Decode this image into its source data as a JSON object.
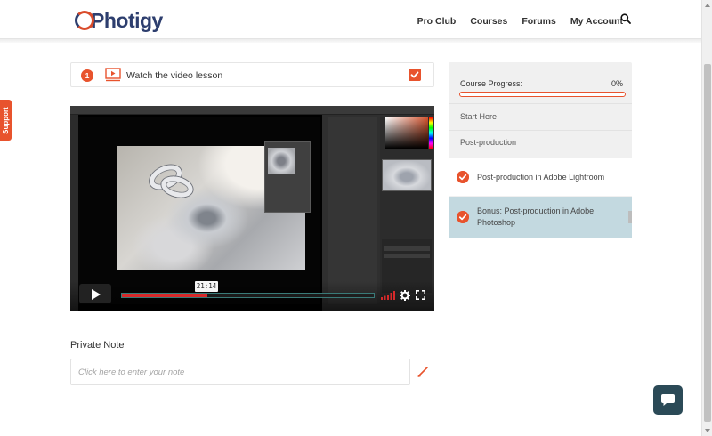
{
  "header": {
    "logo_text": "Photigy",
    "nav": [
      {
        "label": "Pro Club"
      },
      {
        "label": "Courses"
      },
      {
        "label": "Forums"
      },
      {
        "label": "My Account"
      }
    ]
  },
  "support": {
    "label": "Support"
  },
  "step": {
    "number": "1",
    "label": "Watch the video lesson",
    "checked": true
  },
  "video": {
    "time_tooltip": "21:14",
    "played_fraction": 0.34,
    "buffered_fraction": 0.34
  },
  "note": {
    "label": "Private Note",
    "placeholder": "Click here to enter your note"
  },
  "sidebar": {
    "progress_label": "Course Progress:",
    "progress_value": "0%",
    "progress_fraction": 0,
    "items": [
      {
        "label": "Start Here"
      },
      {
        "label": "Post-production"
      }
    ],
    "lessons": [
      {
        "label": "Post-production in Adobe Lightroom",
        "completed": true,
        "active": false
      },
      {
        "label": "Bonus: Post-production in Adobe Photoshop",
        "completed": true,
        "active": true
      }
    ]
  },
  "colors": {
    "accent": "#e8532d",
    "brand_navy": "#2d3e6e",
    "active_lesson_bg": "#c3d9e0",
    "chat_button": "#2b4a57",
    "video_progress": "#d7292a"
  },
  "icons": [
    "search-icon",
    "video-icon",
    "check-icon",
    "play-icon",
    "volume-icon",
    "gear-icon",
    "fullscreen-icon",
    "edit-icon",
    "chat-icon"
  ]
}
